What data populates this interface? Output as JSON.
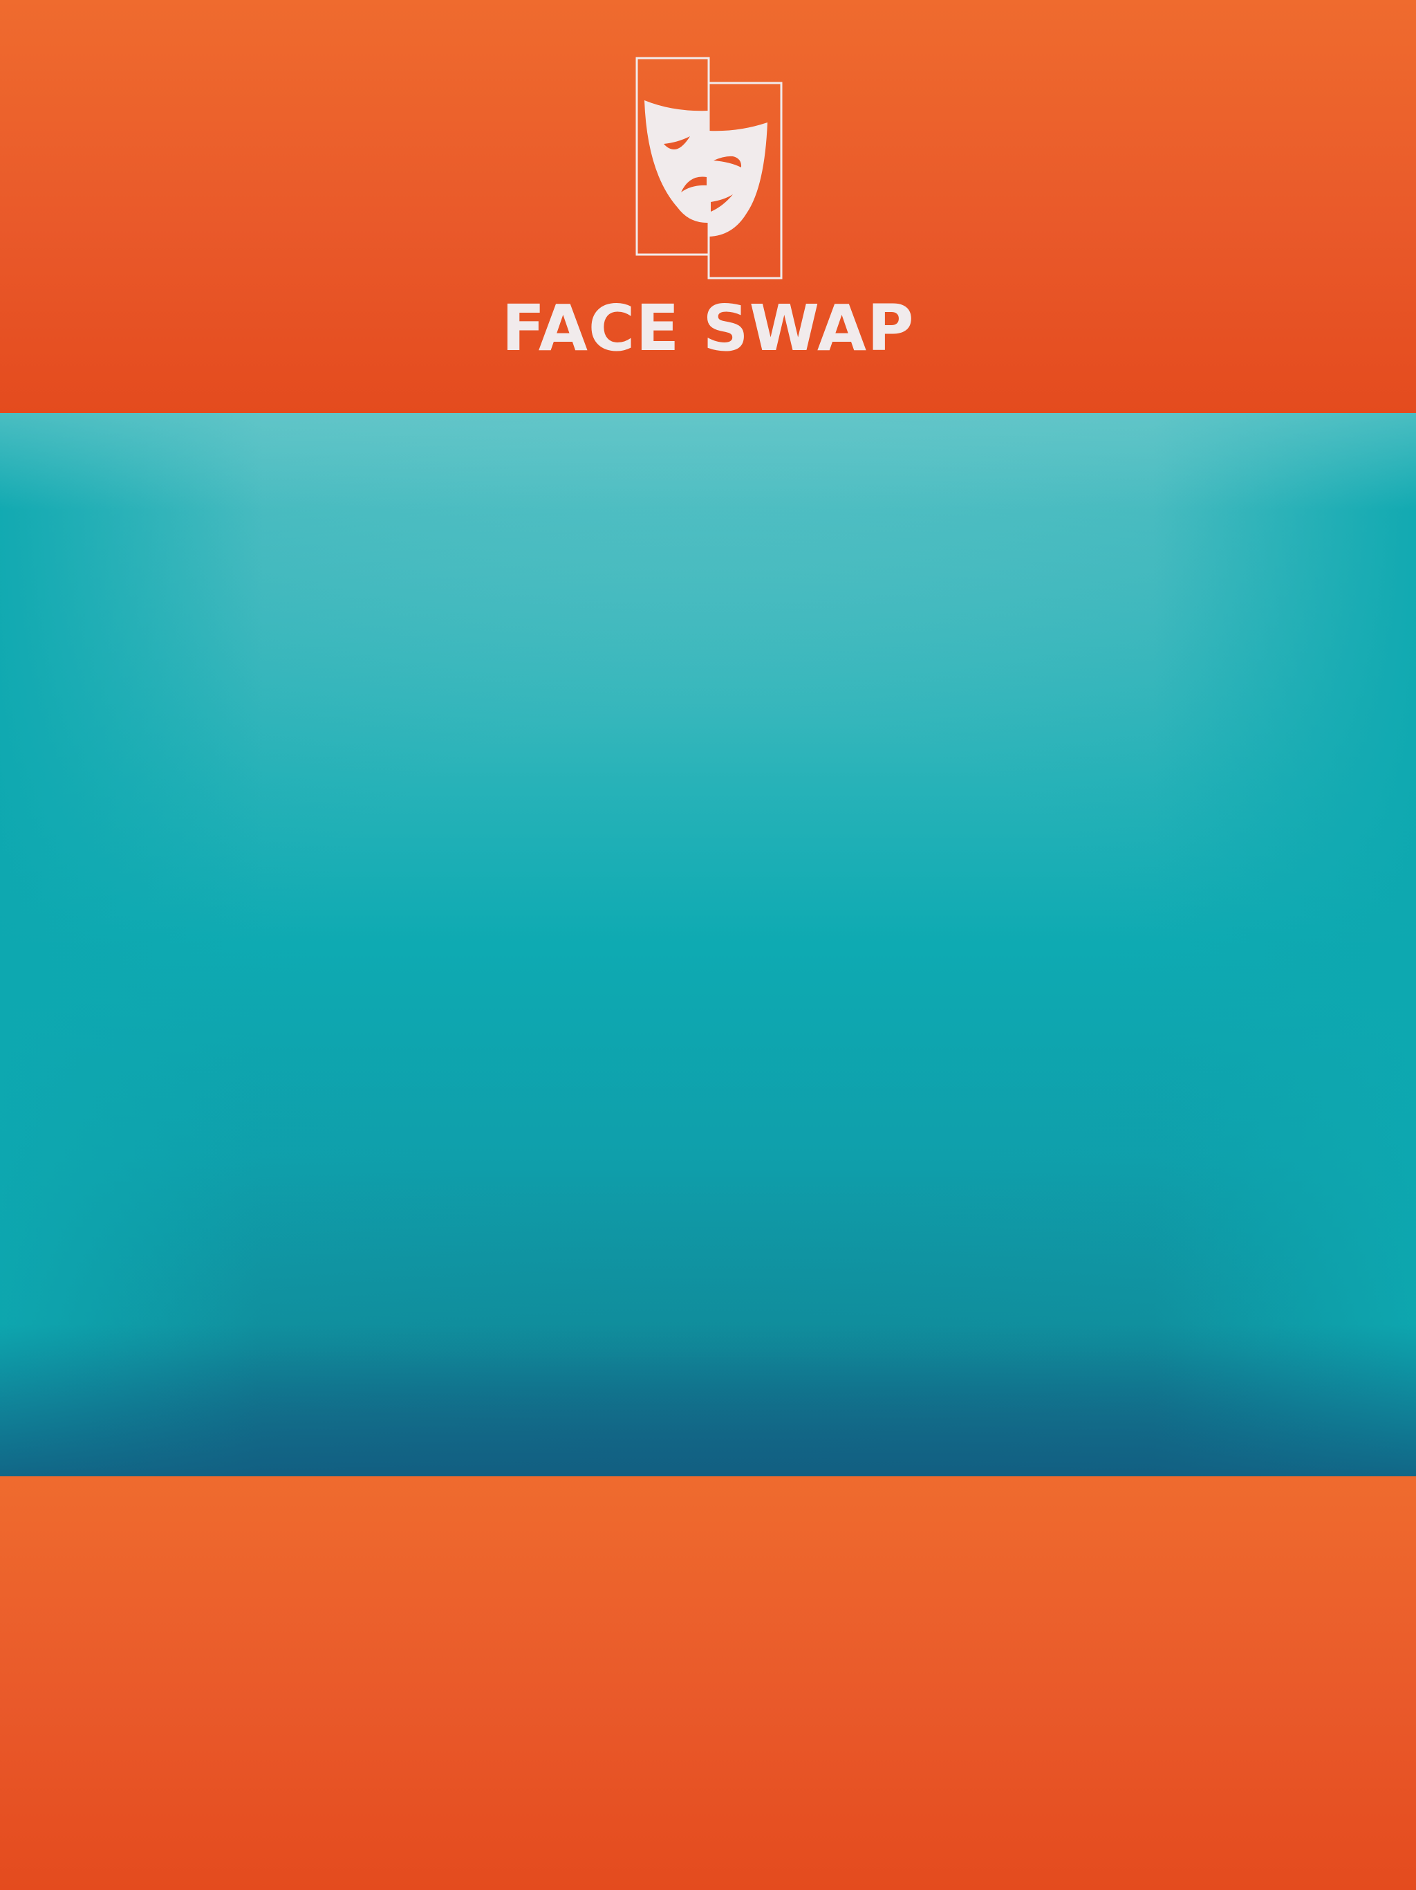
{
  "app": {
    "title": "FACE SWAP",
    "logo_icon": "theater-masks-icon"
  },
  "colors": {
    "header_orange": "#ef6b2e",
    "header_orange_dark": "#e44b1e",
    "stage_teal": "#0eaab2",
    "stage_teal_dark": "#135e80",
    "title_text": "#f1ebec"
  }
}
